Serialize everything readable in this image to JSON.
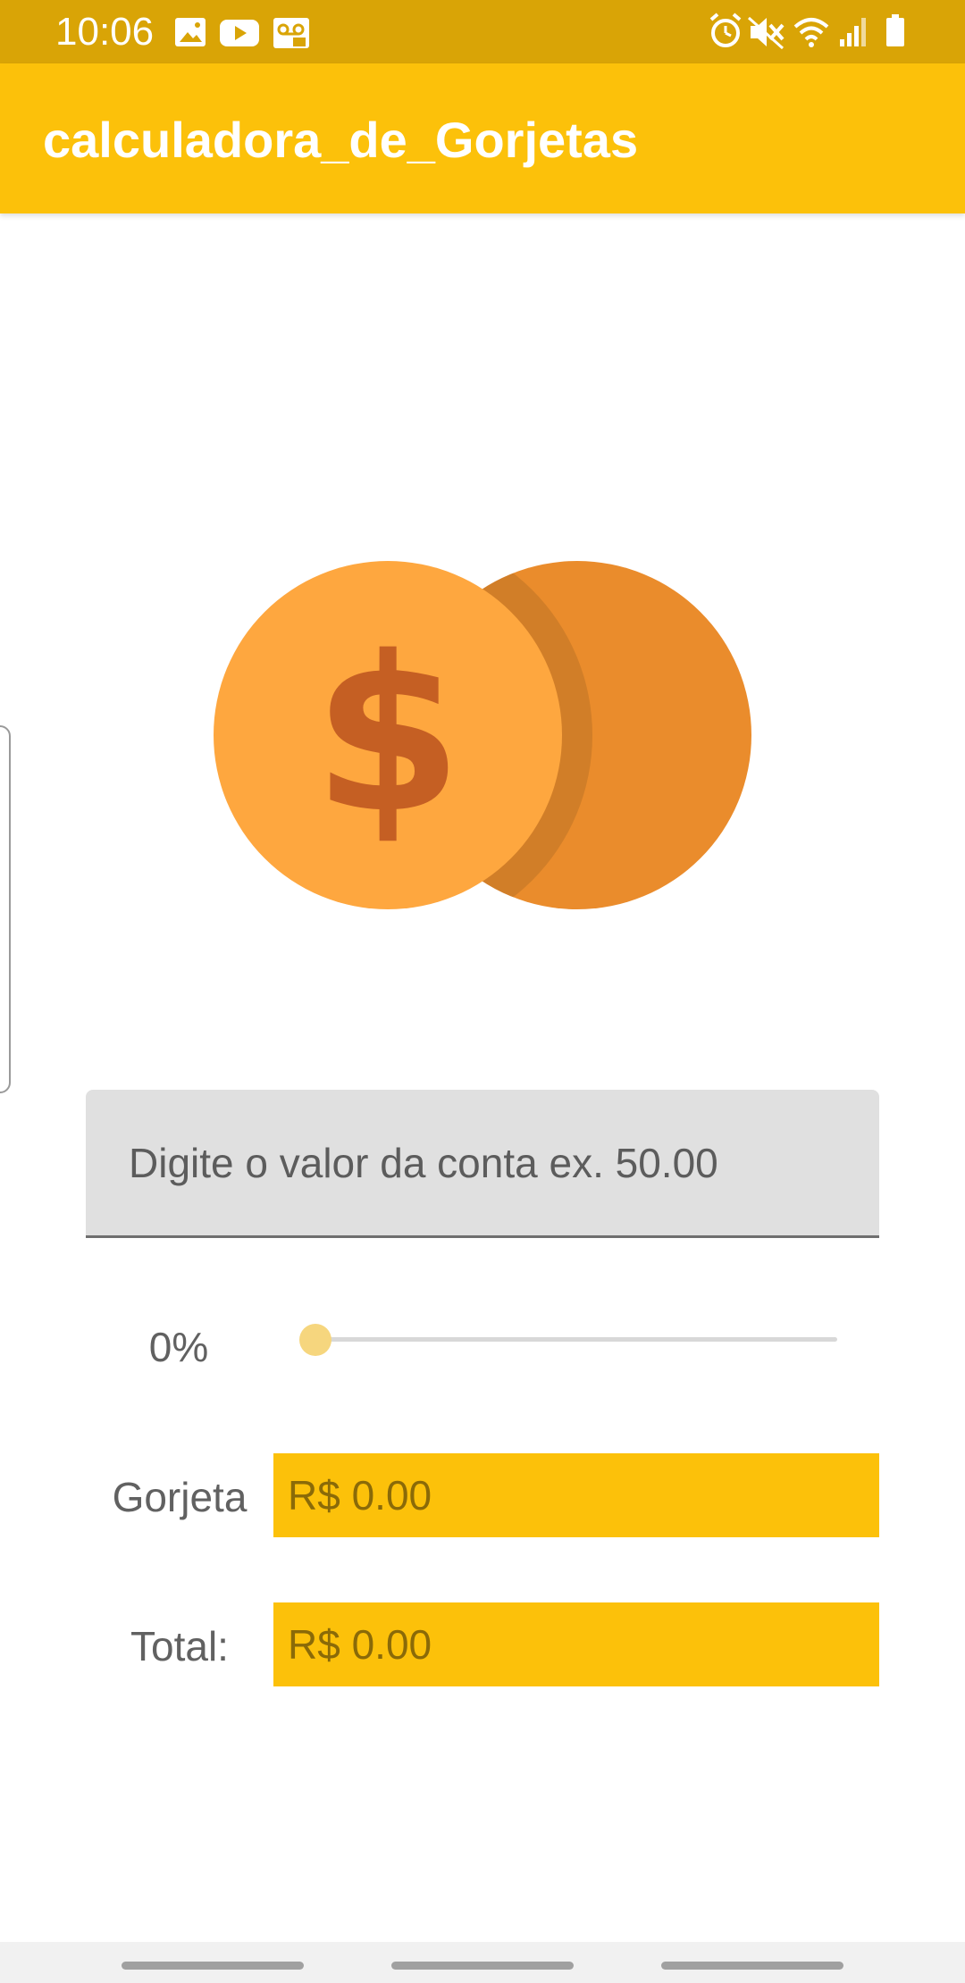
{
  "status_bar": {
    "time": "10:06",
    "left_icons": [
      "image-icon",
      "youtube-icon",
      "voicemail-icon"
    ],
    "right_icons": [
      "alarm-icon",
      "mute-icon",
      "wifi-icon",
      "signal-icon",
      "battery-icon"
    ]
  },
  "app_bar": {
    "title": "calculadora_de_Gorjetas"
  },
  "hero": {
    "icon": "coins-dollar-icon"
  },
  "bill_input": {
    "value": "",
    "placeholder": "Digite o valor da conta ex. 50.00"
  },
  "tip_slider": {
    "label": "0%",
    "value_percent": 0
  },
  "tip_row": {
    "label": "Gorjeta",
    "value": "R$ 0.00"
  },
  "total_row": {
    "label": "Total:",
    "value": "R$ 0.00"
  },
  "colors": {
    "status_bar": "#d9a406",
    "app_bar": "#fcc10a",
    "value_box": "#fcc10a",
    "coin_front": "#fea73f",
    "coin_back": "#ea8c2c",
    "dollar_sign": "#c55f23"
  }
}
